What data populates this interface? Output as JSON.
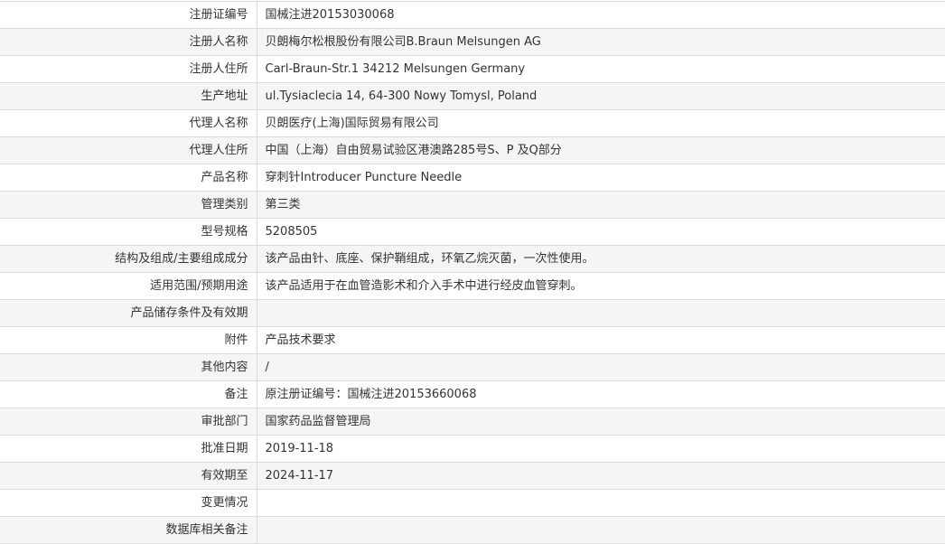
{
  "rows": [
    {
      "label": "注册证编号",
      "value": "国械注进20153030068"
    },
    {
      "label": "注册人名称",
      "value": "贝朗梅尔松根股份有限公司B.Braun Melsungen AG"
    },
    {
      "label": "注册人住所",
      "value": "Carl-Braun-Str.1 34212 Melsungen Germany"
    },
    {
      "label": "生产地址",
      "value": "ul.Tysiaclecia 14, 64-300 Nowy Tomysl, Poland"
    },
    {
      "label": "代理人名称",
      "value": "贝朗医疗(上海)国际贸易有限公司"
    },
    {
      "label": "代理人住所",
      "value": "中国（上海）自由贸易试验区港澳路285号S、P 及Q部分"
    },
    {
      "label": "产品名称",
      "value": "穿刺针Introducer Puncture Needle"
    },
    {
      "label": "管理类别",
      "value": "第三类"
    },
    {
      "label": "型号规格",
      "value": "5208505"
    },
    {
      "label": "结构及组成/主要组成成分",
      "value": "该产品由针、底座、保护鞘组成，环氧乙烷灭菌，一次性使用。"
    },
    {
      "label": "适用范围/预期用途",
      "value": "该产品适用于在血管造影术和介入手术中进行经皮血管穿刺。"
    },
    {
      "label": "产品储存条件及有效期",
      "value": ""
    },
    {
      "label": "附件",
      "value": "产品技术要求"
    },
    {
      "label": "其他内容",
      "value": "/"
    },
    {
      "label": "备注",
      "value": "原注册证编号：国械注进20153660068"
    },
    {
      "label": "审批部门",
      "value": "国家药品监督管理局"
    },
    {
      "label": "批准日期",
      "value": "2019-11-18"
    },
    {
      "label": "有效期至",
      "value": "2024-11-17"
    },
    {
      "label": "变更情况",
      "value": ""
    },
    {
      "label": "数据库相关备注",
      "value": ""
    }
  ]
}
